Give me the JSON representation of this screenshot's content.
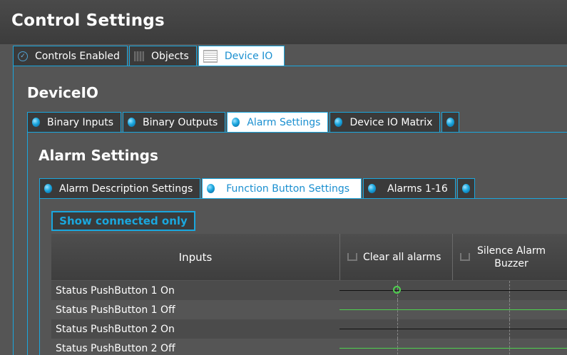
{
  "window": {
    "title": "Control Settings"
  },
  "top_tabs": [
    {
      "label": "Controls Enabled",
      "icon": "check-icon",
      "active": false
    },
    {
      "label": "Objects",
      "icon": "objects-icon",
      "active": false
    },
    {
      "label": "Device IO",
      "icon": "device-io-icon",
      "active": true
    }
  ],
  "device_io": {
    "title": "DeviceIO",
    "tabs": [
      {
        "label": "Binary Inputs",
        "icon": "blue-dot-icon",
        "active": false
      },
      {
        "label": "Binary Outputs",
        "icon": "blue-dot-icon",
        "active": false
      },
      {
        "label": "Alarm Settings",
        "icon": "blue-dot-icon",
        "active": true
      },
      {
        "label": "Device IO Matrix",
        "icon": "blue-dot-icon",
        "active": false
      }
    ]
  },
  "alarm_settings": {
    "title": "Alarm Settings",
    "tabs": [
      {
        "label": "Alarm Description Settings",
        "icon": "blue-dot-icon",
        "active": false
      },
      {
        "label": "Function Button Settings",
        "icon": "blue-dot-icon",
        "active": true
      },
      {
        "label": "Alarms 1-16",
        "icon": "blue-dot-icon",
        "active": false
      }
    ]
  },
  "toolbar": {
    "show_connected_label": "Show connected only"
  },
  "matrix": {
    "columns": {
      "inputs": "Inputs",
      "clear_all": "Clear all alarms",
      "silence": "Silence Alarm Buzzer"
    },
    "rows": [
      {
        "label": "Status PushButton 1 On",
        "line": "black",
        "connected_node": true
      },
      {
        "label": "Status PushButton 1 Off",
        "line": "green",
        "connected_node": false
      },
      {
        "label": "Status PushButton 2 On",
        "line": "black",
        "connected_node": false
      },
      {
        "label": "Status PushButton 2 Off",
        "line": "green",
        "connected_node": false
      }
    ]
  },
  "colors": {
    "accent": "#1aa7de",
    "green_line": "#4fd24f",
    "black_line": "#111111"
  }
}
